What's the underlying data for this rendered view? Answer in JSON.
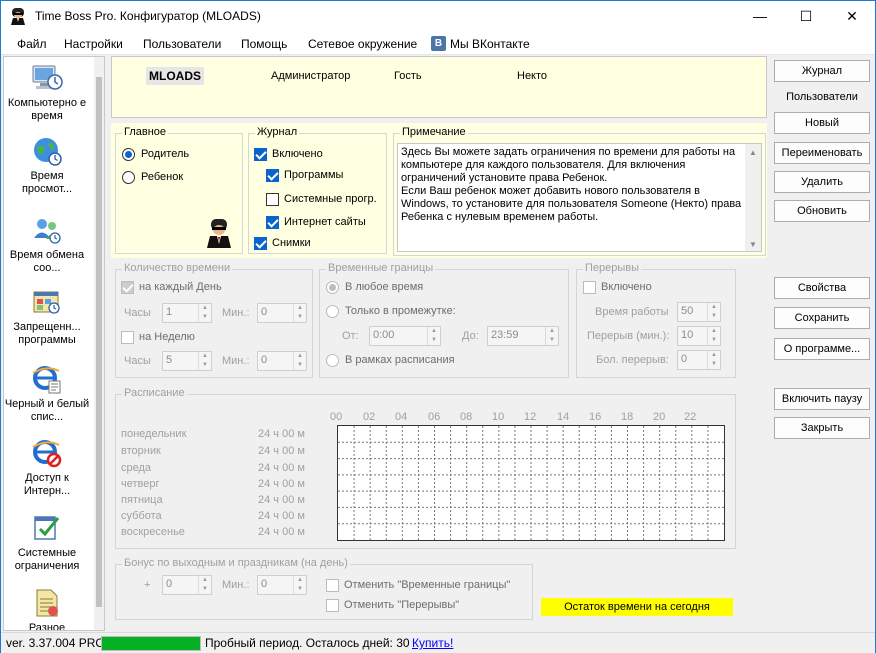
{
  "window": {
    "title": "Time Boss Pro. Конфигуратор (MLOADS)",
    "minimize": "—",
    "maximize": "☐",
    "close": "✕"
  },
  "menu": {
    "items": [
      "Файл",
      "Настройки",
      "Пользователи",
      "Помощь",
      "Сетевое окружение"
    ],
    "vk_badge": "В",
    "vk_label": "Мы ВКонтакте"
  },
  "sidebar": {
    "items": [
      {
        "label": "Компьютерно е время",
        "icon": "computer-icon"
      },
      {
        "label": "Время просмот...",
        "icon": "globe-icon"
      },
      {
        "label": "Время обмена соо...",
        "icon": "users-icon"
      },
      {
        "label": "Запрещенн... программы",
        "icon": "blocked-programs-icon"
      },
      {
        "label": "Черный и белый спис...",
        "icon": "ie-list-icon"
      },
      {
        "label": "Доступ к Интерн...",
        "icon": "ie-blocked-icon"
      },
      {
        "label": "Системные ограничения",
        "icon": "system-check-icon"
      },
      {
        "label": "Разное",
        "icon": "misc-document-icon"
      }
    ]
  },
  "users": {
    "selected": "MLOADS",
    "others": [
      "Администратор",
      "Гость",
      "Некто"
    ]
  },
  "right_panel": {
    "journal": "Журнал",
    "users_label": "Пользователи",
    "new": "Новый",
    "rename": "Переименовать",
    "delete": "Удалить",
    "refresh": "Обновить",
    "properties": "Свойства",
    "save": "Сохранить",
    "about": "О программе...",
    "pause": "Включить паузу",
    "close": "Закрыть"
  },
  "main_group": {
    "title": "Главное",
    "parent": "Родитель",
    "child": "Ребенок",
    "selected": "Родитель"
  },
  "journal_group": {
    "title": "Журнал",
    "enabled": {
      "label": "Включено",
      "checked": true
    },
    "programs": {
      "label": "Программы",
      "checked": true
    },
    "system_progs": {
      "label": "Системные прогр.",
      "checked": false
    },
    "websites": {
      "label": "Интернет сайты",
      "checked": true
    },
    "screenshots": {
      "label": "Снимки",
      "checked": true
    }
  },
  "note": {
    "title": "Примечание",
    "text": "Здесь Вы можете задать ограничения по времени для работы на компьютере для каждого пользователя. Для включения ограничений установите права Ребенок.\nЕсли Ваш ребенок может добавить нового пользователя в Windows, то установите для пользователя Someone (Некто) права Ребенка с нулевым временем работы."
  },
  "time_amount": {
    "title": "Количество времени",
    "per_day": "на каждый День",
    "hours_label": "Часы",
    "hours_value": "1",
    "min_label": "Мин.:",
    "min_value": "0",
    "per_week": "на Неделю",
    "week_hours_label": "Часы",
    "week_hours_value": "5",
    "week_min_label": "Мин.:",
    "week_min_value": "0"
  },
  "time_bounds": {
    "title": "Временные границы",
    "any": "В любое время",
    "interval": "Только в промежутке:",
    "from_label": "От:",
    "from_value": "0:00",
    "to_label": "До:",
    "to_value": "23:59",
    "schedule": "В рамках расписания"
  },
  "breaks": {
    "title": "Перерывы",
    "enabled": "Включено",
    "work_label": "Время работы",
    "work_value": "50",
    "break_label": "Перерыв (мин.):",
    "break_value": "10",
    "ill_label": "Бол. перерыв:",
    "ill_value": "0"
  },
  "schedule": {
    "title": "Расписание",
    "hours": [
      "00",
      "02",
      "04",
      "06",
      "08",
      "10",
      "12",
      "14",
      "16",
      "18",
      "20",
      "22"
    ],
    "days": [
      {
        "name": "понедельник",
        "total": "24 ч 00 м"
      },
      {
        "name": "вторник",
        "total": "24 ч 00 м"
      },
      {
        "name": "среда",
        "total": "24 ч 00 м"
      },
      {
        "name": "четверг",
        "total": "24 ч 00 м"
      },
      {
        "name": "пятница",
        "total": "24 ч 00 м"
      },
      {
        "name": "суббота",
        "total": "24 ч 00 м"
      },
      {
        "name": "воскресенье",
        "total": "24 ч 00 м"
      }
    ]
  },
  "bonus": {
    "title": "Бонус по выходным и праздникам (на день)",
    "plus": "+",
    "hours_value": "0",
    "min_label": "Мин.:",
    "min_value": "0",
    "cancel_bounds": "Отменить \"Временные границы\"",
    "cancel_breaks": "Отменить \"Перерывы\""
  },
  "remaining_button": "Остаток времени на сегодня",
  "status": {
    "version": "ver. 3.37.004 PRO",
    "progress": 1.0,
    "trial": "Пробный период. Осталось дней: 30",
    "buy": "Купить!"
  },
  "colors": {
    "accent": "#0a64d0",
    "panel_yellow": "#ffffe1",
    "progress_green": "#06b025",
    "highlight_yellow": "#ffff00",
    "link_blue": "#0000ff"
  }
}
